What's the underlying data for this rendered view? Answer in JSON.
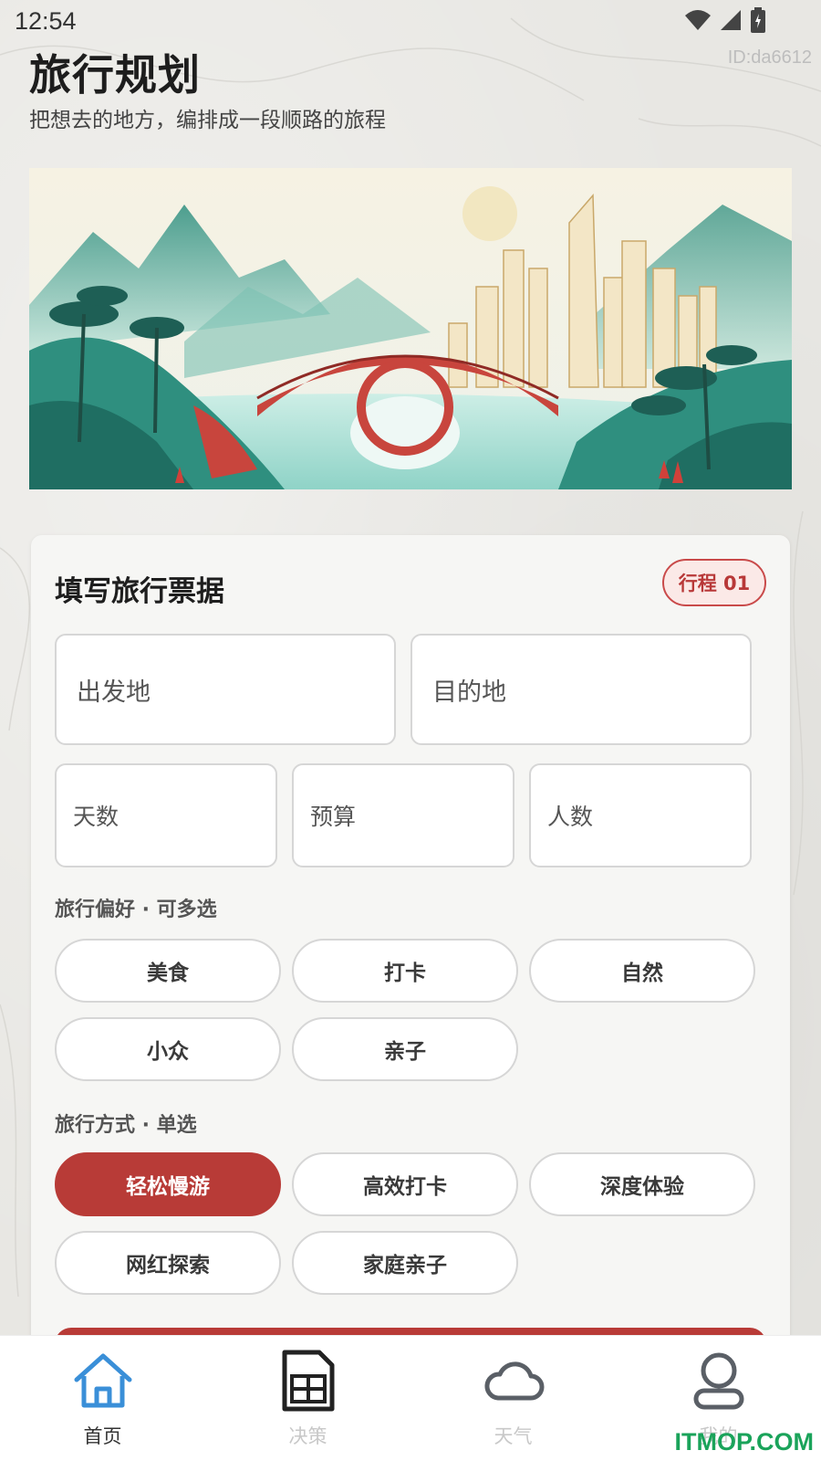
{
  "status_bar": {
    "time": "12:54"
  },
  "header": {
    "title": "旅行规划",
    "subtitle": "把想去的地方，编排成一段顺路的旅程",
    "user_id": "ID:da6612"
  },
  "form": {
    "title": "填写旅行票据",
    "trip_badge": "行程 01",
    "fields": {
      "origin_placeholder": "出发地",
      "destination_placeholder": "目的地",
      "days_placeholder": "天数",
      "budget_placeholder": "预算",
      "people_placeholder": "人数"
    },
    "preferences": {
      "label": "旅行偏好 · 可多选",
      "options": [
        "美食",
        "打卡",
        "自然",
        "小众",
        "亲子"
      ]
    },
    "mode": {
      "label": "旅行方式 · 单选",
      "options": [
        "轻松慢游",
        "高效打卡",
        "深度体验",
        "网红探索",
        "家庭亲子"
      ],
      "selected": "轻松慢游"
    }
  },
  "bottom_nav": {
    "items": [
      {
        "label": "首页",
        "icon": "home-icon",
        "active": true
      },
      {
        "label": "决策",
        "icon": "decision-sheet-icon",
        "active": false
      },
      {
        "label": "天气",
        "icon": "cloud-icon",
        "active": false
      },
      {
        "label": "我的",
        "icon": "user-icon",
        "active": false
      }
    ]
  },
  "watermark": "ITMOP.COM",
  "colors": {
    "accent": "#b83b37",
    "nav_active": "#3a8fd8",
    "background": "#e8e7e3"
  }
}
